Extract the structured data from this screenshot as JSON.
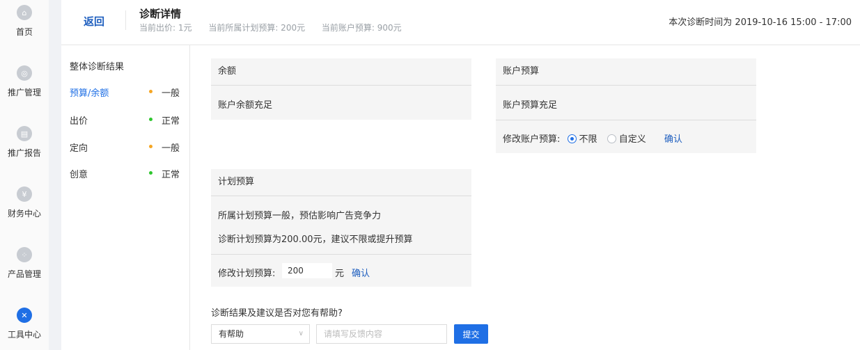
{
  "nav": {
    "items": [
      {
        "label": "首页",
        "icon": "home-icon",
        "glyph": "⌂"
      },
      {
        "label": "推广管理",
        "icon": "promotion-icon",
        "glyph": "◎"
      },
      {
        "label": "推广报告",
        "icon": "report-icon",
        "glyph": "▤"
      },
      {
        "label": "财务中心",
        "icon": "yuan-icon",
        "glyph": "¥"
      },
      {
        "label": "产品管理",
        "icon": "grid-icon",
        "glyph": "⁘"
      },
      {
        "label": "工具中心",
        "icon": "tools-icon",
        "glyph": "✕"
      }
    ]
  },
  "header": {
    "back": "返回",
    "title": "诊断详情",
    "current_bid": "当前出价: 1元",
    "plan_budget": "当前所属计划预算: 200元",
    "account_budget": "当前账户预算: 900元",
    "diagnosis_time": "本次诊断时间为 2019-10-16 15:00 - 17:00"
  },
  "diagnosis": {
    "heading": "整体诊断结果",
    "items": [
      {
        "name": "预算/余额",
        "status": "一般",
        "dot_color": "#f5a623"
      },
      {
        "name": "出价",
        "status": "正常",
        "dot_color": "#2ec62e"
      },
      {
        "name": "定向",
        "status": "一般",
        "dot_color": "#f5a623"
      },
      {
        "name": "创意",
        "status": "正常",
        "dot_color": "#2ec62e"
      }
    ]
  },
  "balance_panel": {
    "title": "余额",
    "text": "账户余额充足"
  },
  "account_panel": {
    "title": "账户预算",
    "text": "账户预算充足",
    "edit_label": "修改账户预算:",
    "option_unlimited": "不限",
    "option_custom": "自定义",
    "confirm": "确认"
  },
  "plan_panel": {
    "title": "计划预算",
    "line1": "所属计划预算一般，预估影响广告竞争力",
    "line2": "诊断计划预算为200.00元，建议不限或提升预算",
    "edit_label": "修改计划预算:",
    "value": "200",
    "unit": "元",
    "confirm": "确认"
  },
  "feedback": {
    "question": "诊断结果及建议是否对您有帮助?",
    "select_value": "有帮助",
    "placeholder": "请填写反馈内容",
    "submit": "提交"
  },
  "colors": {
    "accent": "#1f6fe5",
    "link": "#1f5fbf",
    "warn": "#f5a623",
    "ok": "#2ec62e"
  }
}
